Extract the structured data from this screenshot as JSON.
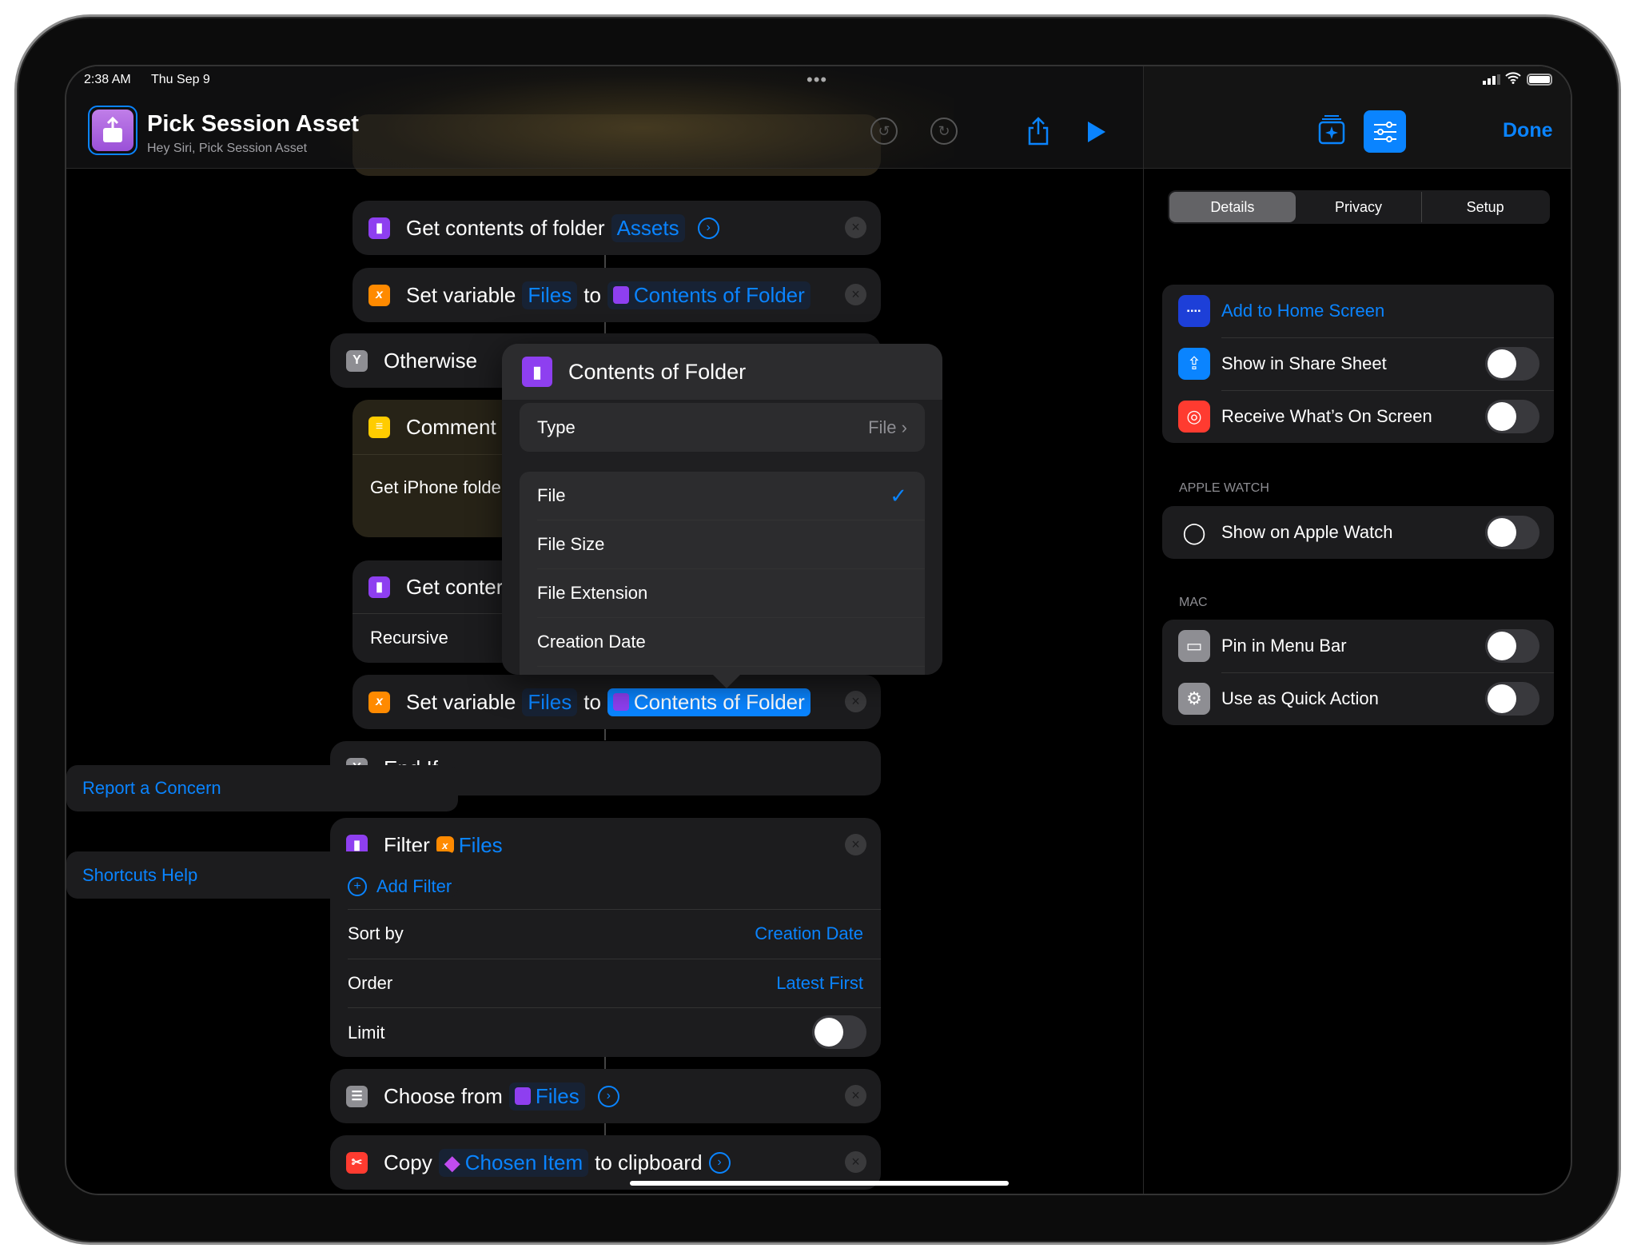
{
  "status_bar": {
    "time": "2:38 AM",
    "date": "Thu Sep 9"
  },
  "header": {
    "title": "Pick Session Asset",
    "subtitle": "Hey Siri, Pick Session Asset",
    "icons": [
      "undo-icon",
      "redo-icon",
      "share-icon",
      "play-icon"
    ]
  },
  "right_header": {
    "done_label": "Done",
    "icons": [
      "shortcut-gallery-icon",
      "settings-sliders-icon"
    ]
  },
  "actions": {
    "get_folder_1": {
      "text": "Get contents of folder",
      "token": "Assets"
    },
    "set_var_1": {
      "text": "Set variable",
      "var": "Files",
      "to": "to",
      "value": "Contents of Folder"
    },
    "otherwise": {
      "text": "Otherwise"
    },
    "comment": {
      "text": "Comment",
      "body": "Get iPhone folde"
    },
    "get_folder_2": {
      "text": "Get conter",
      "option": "Recursive"
    },
    "set_var_2": {
      "text": "Set variable",
      "var": "Files",
      "to": "to",
      "value": "Contents of Folder"
    },
    "end_if": {
      "text": "End If"
    },
    "filter": {
      "text": "Filter",
      "token": "Files",
      "add_filter": "Add Filter",
      "sort_by_label": "Sort by",
      "sort_by_value": "Creation Date",
      "order_label": "Order",
      "order_value": "Latest First",
      "limit_label": "Limit",
      "limit_on": false
    },
    "choose": {
      "text": "Choose from",
      "token": "Files"
    },
    "copy": {
      "text": "Copy",
      "token": "Chosen Item",
      "suffix": "to clipboard"
    }
  },
  "popup": {
    "title": "Contents of Folder",
    "type_label": "Type",
    "type_value": "File",
    "options": [
      "File",
      "File Size",
      "File Extension",
      "Creation Date"
    ],
    "selected": "File"
  },
  "sidebar": {
    "tabs": [
      {
        "label": "Details",
        "active": true
      },
      {
        "label": "Privacy",
        "active": false
      },
      {
        "label": "Setup",
        "active": false
      }
    ],
    "group1": [
      {
        "label": "Add to Home Screen",
        "link": true
      },
      {
        "label": "Show in Share Sheet",
        "on": false
      },
      {
        "label": "Receive What’s On Screen",
        "on": false
      }
    ],
    "apple_watch_header": "APPLE WATCH",
    "apple_watch": [
      {
        "label": "Show on Apple Watch",
        "on": false
      }
    ],
    "mac_header": "MAC",
    "mac": [
      {
        "label": "Pin in Menu Bar",
        "on": false
      },
      {
        "label": "Use as Quick Action",
        "on": false
      }
    ],
    "report": "Report a Concern",
    "help": "Shortcuts Help"
  },
  "colors": {
    "accent": "#0a84ff",
    "background": "#000000",
    "card": "#1c1c1e"
  }
}
